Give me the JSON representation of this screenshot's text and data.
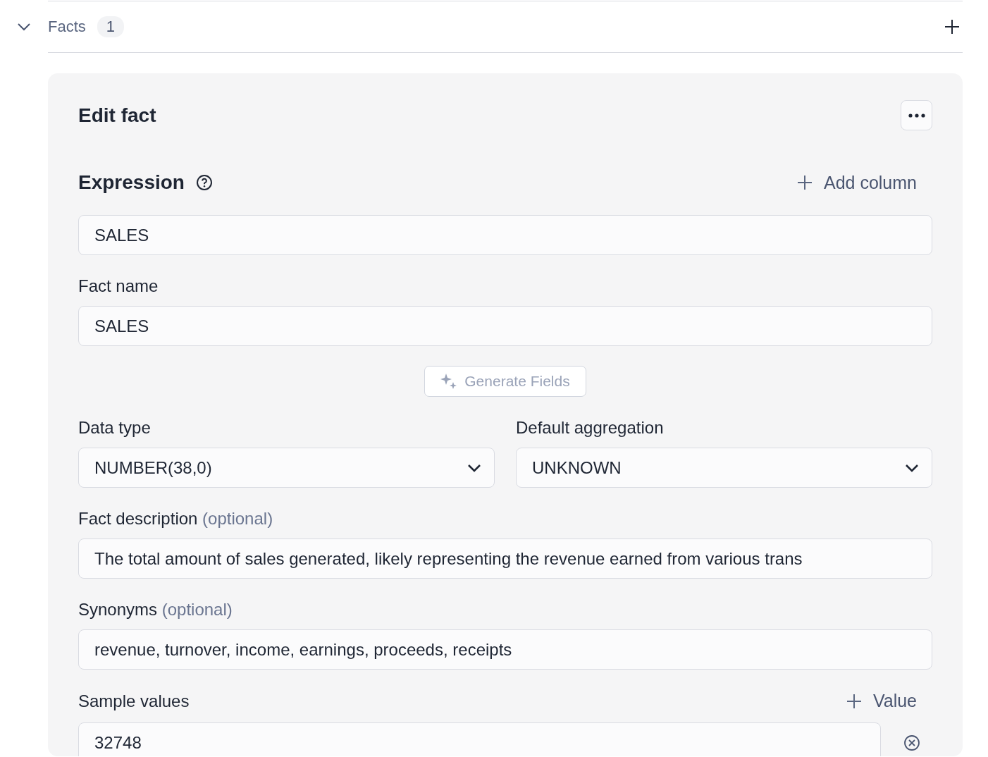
{
  "section": {
    "title": "Facts",
    "count": "1",
    "expanded": true
  },
  "editor": {
    "title": "Edit fact",
    "expression": {
      "label": "Expression",
      "add_label": "Add column",
      "value": "SALES"
    },
    "fact_name": {
      "label": "Fact name",
      "value": "SALES"
    },
    "generate": {
      "label": "Generate Fields",
      "disabled": true
    },
    "data_type": {
      "label": "Data type",
      "value": "NUMBER(38,0)"
    },
    "aggregation": {
      "label": "Default aggregation",
      "value": "UNKNOWN"
    },
    "description": {
      "label": "Fact description",
      "optional": "(optional)",
      "value": "The total amount of sales generated, likely representing the revenue earned from various trans"
    },
    "synonyms": {
      "label": "Synonyms",
      "optional": "(optional)",
      "value": "revenue, turnover, income, earnings, proceeds, receipts"
    },
    "sample_values": {
      "label": "Sample values",
      "add_label": "Value",
      "values": [
        "32748"
      ]
    }
  }
}
